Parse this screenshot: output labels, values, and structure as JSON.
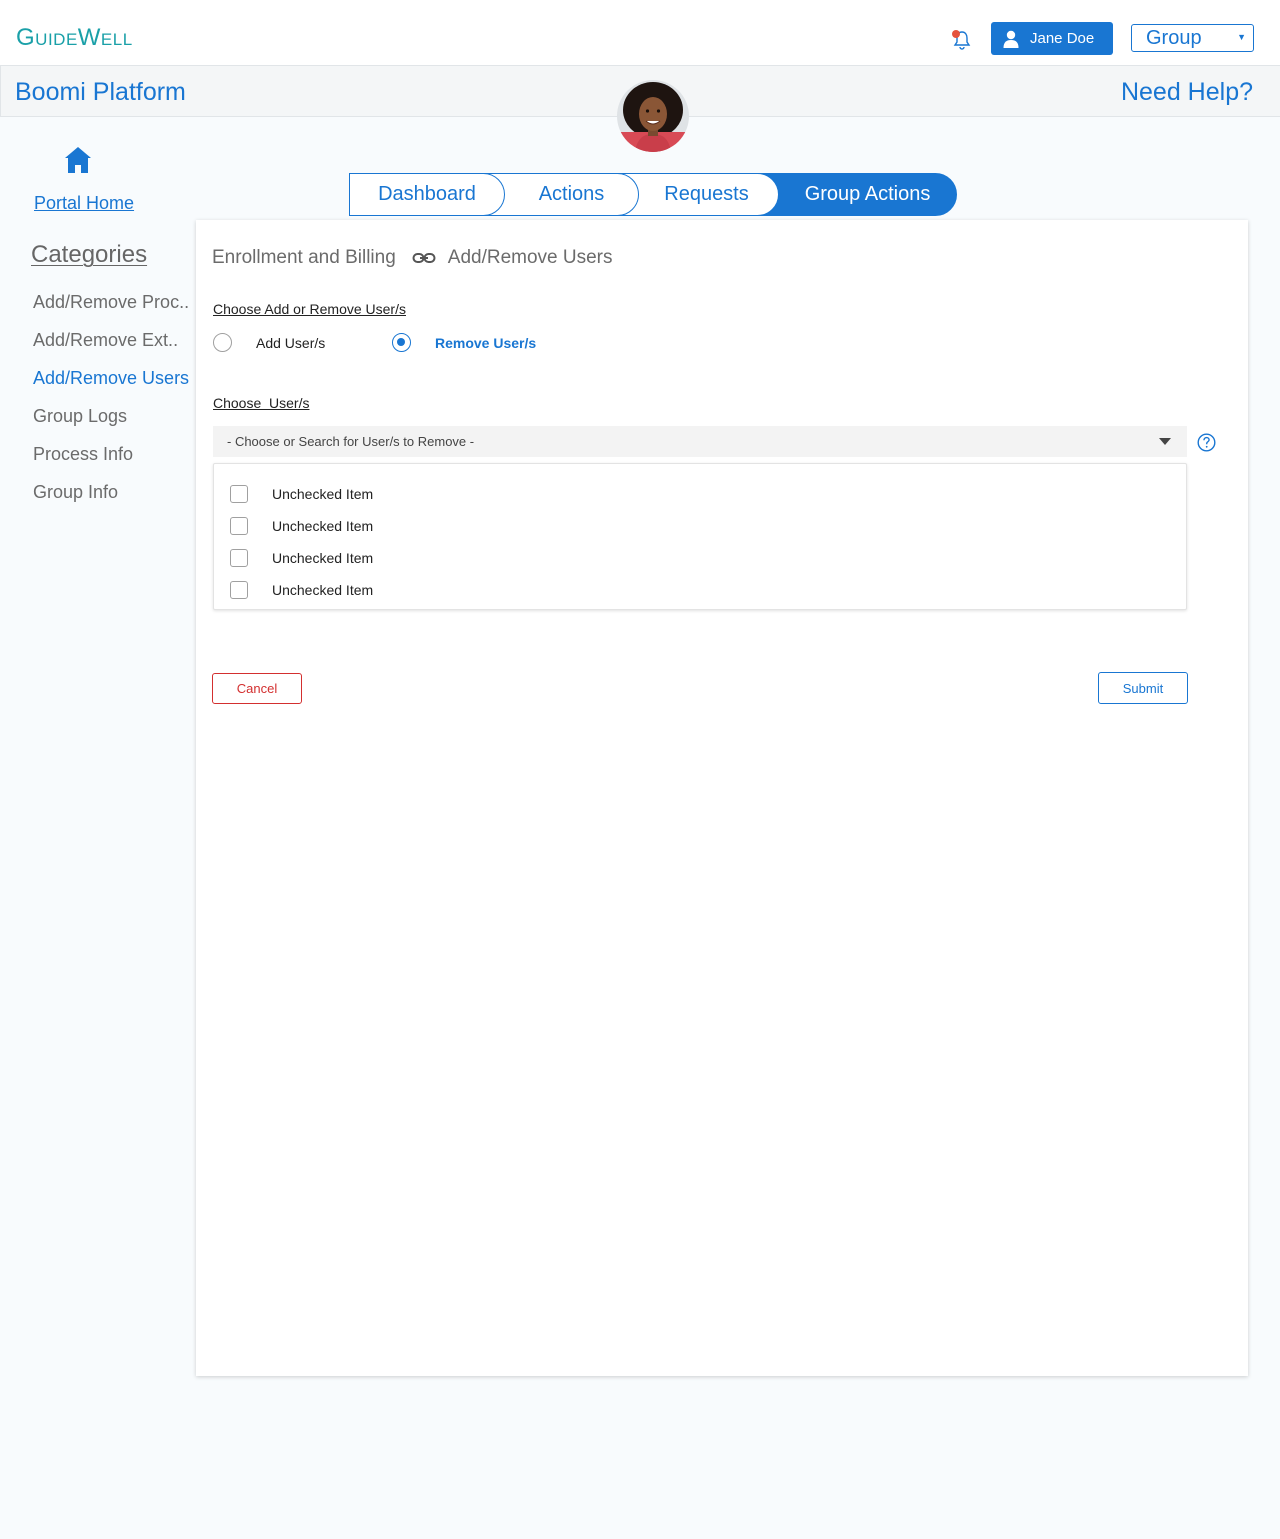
{
  "header": {
    "logo_text": "GuideWell",
    "user_name": "Jane Doe",
    "group_select_value": "Group"
  },
  "platform_bar": {
    "title": "Boomi Platform",
    "help_link": "Need Help?"
  },
  "sidebar": {
    "home_link": "Portal Home",
    "categories_heading": "Categories",
    "items": [
      {
        "label": "Add/Remove Proc.."
      },
      {
        "label": "Add/Remove Ext.."
      },
      {
        "label": "Add/Remove Users"
      },
      {
        "label": "Group Logs"
      },
      {
        "label": "Process Info"
      },
      {
        "label": "Group Info"
      }
    ],
    "active_item": "Add/Remove Users"
  },
  "tabs": [
    {
      "label": "Dashboard"
    },
    {
      "label": "Actions"
    },
    {
      "label": "Requests"
    },
    {
      "label": "Group Actions"
    }
  ],
  "active_tab": "Group Actions",
  "main": {
    "breadcrumb": {
      "parent": "Enrollment and Billing",
      "current": "Add/Remove Users"
    },
    "mode_label": "Choose Add or Remove User/s",
    "mode_options": [
      {
        "label": "Add User/s",
        "checked": false
      },
      {
        "label": "Remove User/s",
        "checked": true
      }
    ],
    "users_label": "Choose  User/s",
    "users_dropdown_placeholder": "- Choose or Search for User/s to Remove -",
    "user_items": [
      {
        "label": "Unchecked Item",
        "checked": false
      },
      {
        "label": "Unchecked Item",
        "checked": false
      },
      {
        "label": "Unchecked Item",
        "checked": false
      },
      {
        "label": "Unchecked Item",
        "checked": false
      }
    ],
    "cancel_label": "Cancel",
    "submit_label": "Submit"
  },
  "colors": {
    "primary": "#1976d2",
    "logo": "#1aa0a8",
    "danger": "#d32f2f",
    "notification_dot": "#e5533d"
  }
}
